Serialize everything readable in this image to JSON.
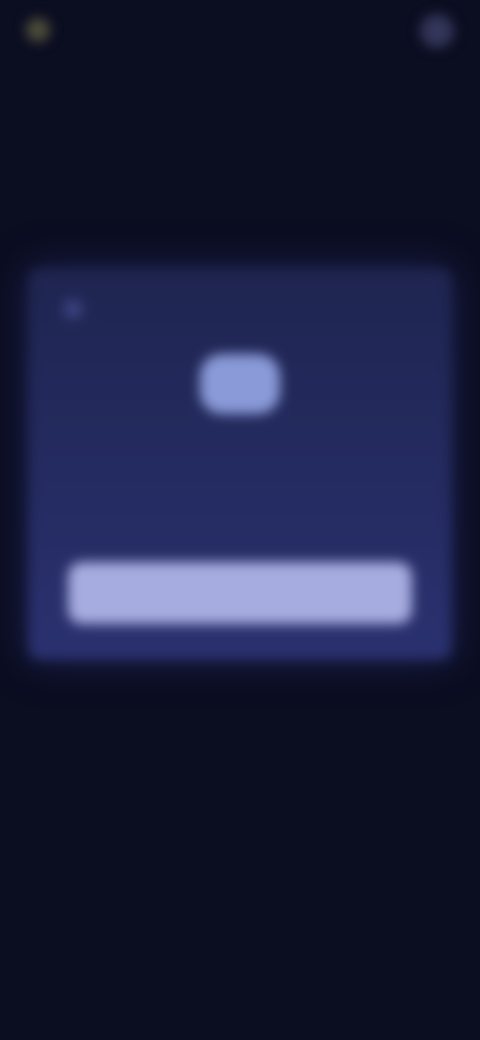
{
  "header": {
    "brand_name": "",
    "link_label": ""
  },
  "main": {
    "page_title": ""
  },
  "card": {
    "heading": "",
    "text": "",
    "button_label": ""
  },
  "colors": {
    "background": "#0b0d21",
    "card_top": "#1f2550",
    "card_bottom": "#2a3170",
    "emblem": "#8a9ad8",
    "button": "#a6acdf",
    "brand_accent": "#5b5a3e"
  },
  "icons": {
    "brand": "logo-icon",
    "avatar": "avatar",
    "card_corner": "card-icon"
  }
}
